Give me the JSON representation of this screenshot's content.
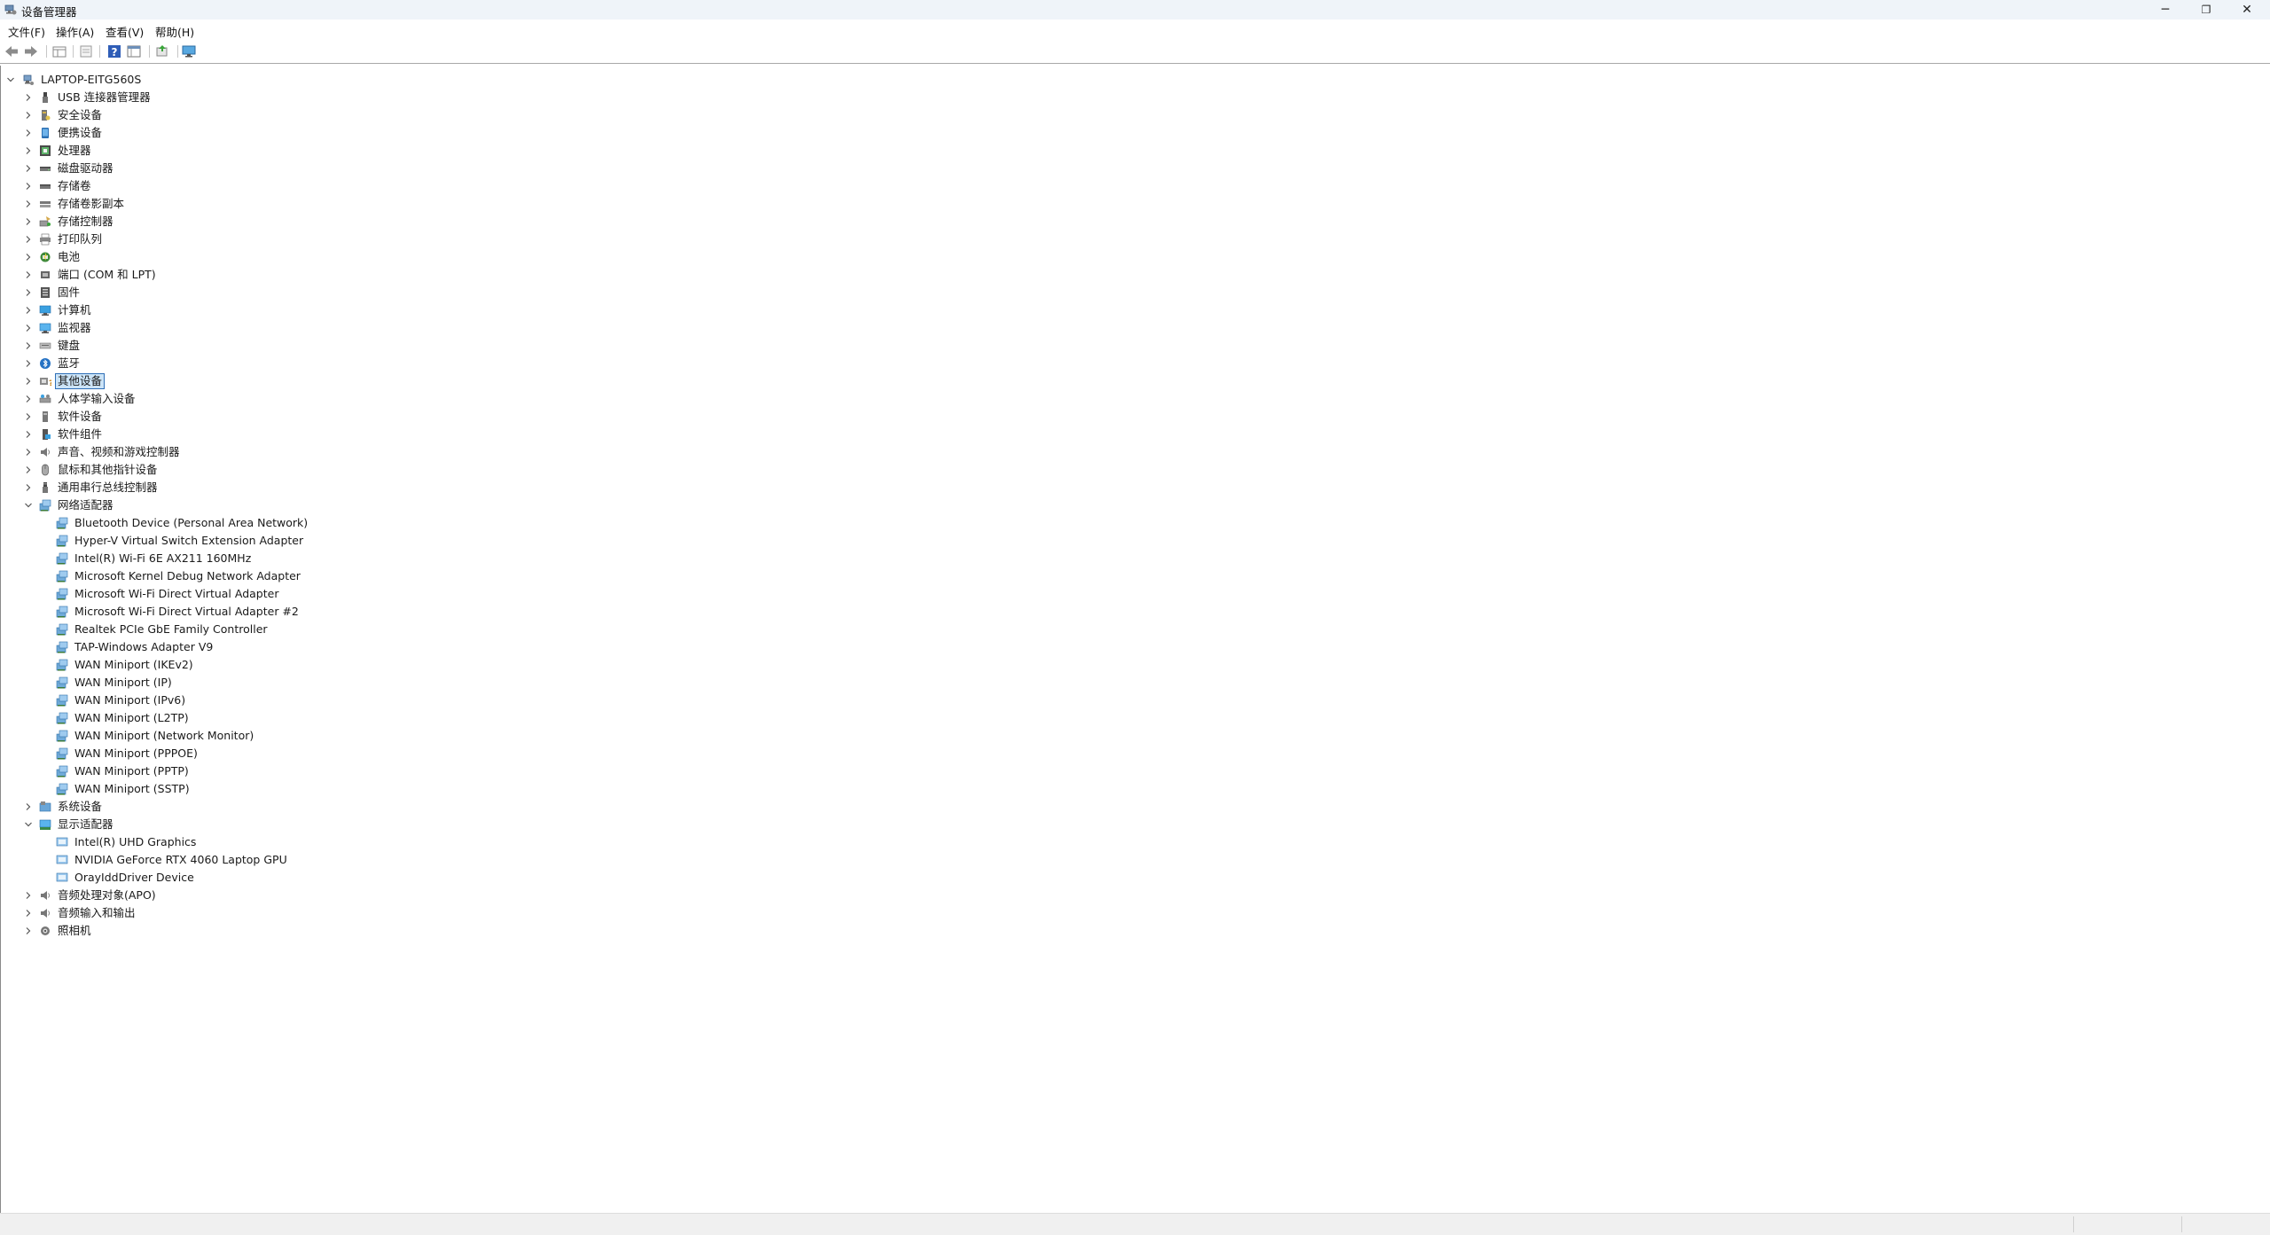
{
  "window": {
    "title": "设备管理器",
    "buttons": {
      "minimize": "─",
      "restore": "❐",
      "close": "✕"
    }
  },
  "menu": [
    "文件(F)",
    "操作(A)",
    "查看(V)",
    "帮助(H)"
  ],
  "toolbar": [
    "back-icon",
    "forward-icon",
    "show-hide-tree-icon",
    "properties-icon",
    "help-icon",
    "view-icon",
    "update-driver-icon",
    "monitor-icon"
  ],
  "tree": {
    "root": "LAPTOP-EITG560S",
    "items": [
      {
        "label": "USB 连接器管理器",
        "icon": "usb-connector-icon",
        "expanded": false
      },
      {
        "label": "安全设备",
        "icon": "security-device-icon",
        "expanded": false
      },
      {
        "label": "便携设备",
        "icon": "portable-device-icon",
        "expanded": false
      },
      {
        "label": "处理器",
        "icon": "processor-icon",
        "expanded": false
      },
      {
        "label": "磁盘驱动器",
        "icon": "disk-drive-icon",
        "expanded": false
      },
      {
        "label": "存储卷",
        "icon": "storage-volume-icon",
        "expanded": false
      },
      {
        "label": "存储卷影副本",
        "icon": "shadow-copy-icon",
        "expanded": false
      },
      {
        "label": "存储控制器",
        "icon": "storage-controller-icon",
        "expanded": false
      },
      {
        "label": "打印队列",
        "icon": "printer-icon",
        "expanded": false
      },
      {
        "label": "电池",
        "icon": "battery-icon",
        "expanded": false
      },
      {
        "label": "端口 (COM 和 LPT)",
        "icon": "port-icon",
        "expanded": false
      },
      {
        "label": "固件",
        "icon": "firmware-icon",
        "expanded": false
      },
      {
        "label": "计算机",
        "icon": "computer-icon",
        "expanded": false
      },
      {
        "label": "监视器",
        "icon": "monitor-icon",
        "expanded": false
      },
      {
        "label": "键盘",
        "icon": "keyboard-icon",
        "expanded": false
      },
      {
        "label": "蓝牙",
        "icon": "bluetooth-icon",
        "expanded": false
      },
      {
        "label": "其他设备",
        "icon": "other-device-icon",
        "expanded": false,
        "selected": true
      },
      {
        "label": "人体学输入设备",
        "icon": "hid-icon",
        "expanded": false
      },
      {
        "label": "软件设备",
        "icon": "software-device-icon",
        "expanded": false
      },
      {
        "label": "软件组件",
        "icon": "software-component-icon",
        "expanded": false
      },
      {
        "label": "声音、视频和游戏控制器",
        "icon": "sound-icon",
        "expanded": false
      },
      {
        "label": "鼠标和其他指针设备",
        "icon": "mouse-icon",
        "expanded": false
      },
      {
        "label": "通用串行总线控制器",
        "icon": "usb-controller-icon",
        "expanded": false
      },
      {
        "label": "网络适配器",
        "icon": "network-adapter-icon",
        "expanded": true,
        "children": [
          {
            "label": "Bluetooth Device (Personal Area Network)",
            "icon": "network-adapter-icon"
          },
          {
            "label": "Hyper-V Virtual Switch Extension Adapter",
            "icon": "network-adapter-icon"
          },
          {
            "label": "Intel(R) Wi-Fi 6E AX211 160MHz",
            "icon": "network-adapter-icon"
          },
          {
            "label": "Microsoft Kernel Debug Network Adapter",
            "icon": "network-adapter-icon"
          },
          {
            "label": "Microsoft Wi-Fi Direct Virtual Adapter",
            "icon": "network-adapter-icon"
          },
          {
            "label": "Microsoft Wi-Fi Direct Virtual Adapter #2",
            "icon": "network-adapter-icon"
          },
          {
            "label": "Realtek PCIe GbE Family Controller",
            "icon": "network-adapter-icon"
          },
          {
            "label": "TAP-Windows Adapter V9",
            "icon": "network-adapter-icon"
          },
          {
            "label": "WAN Miniport (IKEv2)",
            "icon": "network-adapter-icon"
          },
          {
            "label": "WAN Miniport (IP)",
            "icon": "network-adapter-icon"
          },
          {
            "label": "WAN Miniport (IPv6)",
            "icon": "network-adapter-icon"
          },
          {
            "label": "WAN Miniport (L2TP)",
            "icon": "network-adapter-icon"
          },
          {
            "label": "WAN Miniport (Network Monitor)",
            "icon": "network-adapter-icon"
          },
          {
            "label": "WAN Miniport (PPPOE)",
            "icon": "network-adapter-icon"
          },
          {
            "label": "WAN Miniport (PPTP)",
            "icon": "network-adapter-icon"
          },
          {
            "label": "WAN Miniport (SSTP)",
            "icon": "network-adapter-icon"
          }
        ]
      },
      {
        "label": "系统设备",
        "icon": "system-device-icon",
        "expanded": false
      },
      {
        "label": "显示适配器",
        "icon": "display-adapter-icon",
        "expanded": true,
        "children": [
          {
            "label": "Intel(R) UHD Graphics",
            "icon": "display-device-icon"
          },
          {
            "label": "NVIDIA GeForce RTX 4060 Laptop GPU",
            "icon": "display-device-icon"
          },
          {
            "label": "OrayIddDriver Device",
            "icon": "display-device-icon"
          }
        ]
      },
      {
        "label": "音频处理对象(APO)",
        "icon": "audio-apo-icon",
        "expanded": false
      },
      {
        "label": "音频输入和输出",
        "icon": "audio-io-icon",
        "expanded": false
      },
      {
        "label": "照相机",
        "icon": "camera-icon",
        "expanded": false
      }
    ]
  },
  "colors": {
    "titlebar": "#eff4f9",
    "selection": "#cce4f7",
    "selection_border": "#2f6fb7",
    "accent": "#2f7fd0"
  }
}
